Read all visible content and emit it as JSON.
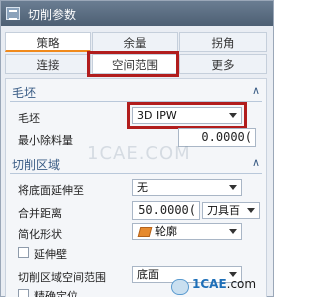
{
  "window": {
    "title": "切削参数"
  },
  "tabs": {
    "row1": [
      {
        "label": "策略"
      },
      {
        "label": "余量"
      },
      {
        "label": "拐角"
      }
    ],
    "row2": [
      {
        "label": "连接"
      },
      {
        "label": "空间范围"
      },
      {
        "label": "更多"
      }
    ]
  },
  "blank_section": {
    "title": "毛坯",
    "blank_label": "毛坯",
    "blank_value": "3D IPW",
    "min_removal_label": "最小除料量",
    "min_removal_value": "0.0000("
  },
  "cut_area_section": {
    "title": "切削区域",
    "extend_floor_label": "将底面延伸至",
    "extend_floor_value": "无",
    "merge_distance_label": "合并距离",
    "merge_distance_value": "50.0000(",
    "merge_distance_unit": "刀具百",
    "simplify_shape_label": "简化形状",
    "simplify_shape_value": "轮廓",
    "extend_wall_label": "延伸壁",
    "cut_area_space_label": "切削区域空间范围",
    "cut_area_space_value": "底面",
    "precise_locate_label": "精确定位"
  },
  "watermark": "1CAE.COM",
  "brand": {
    "part1": "1CAE",
    "part2": ".com"
  }
}
